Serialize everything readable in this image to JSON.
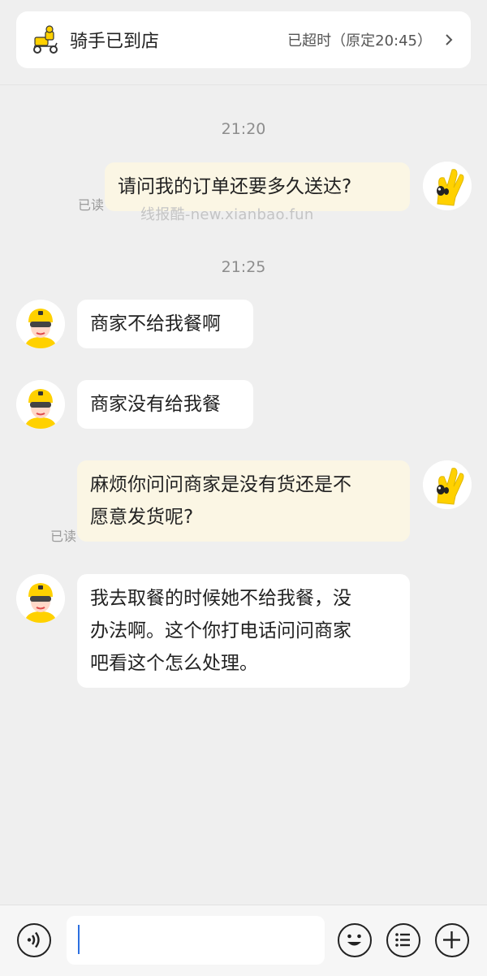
{
  "status": {
    "title": "骑手已到店",
    "time_text": "已超时（原定20:45）"
  },
  "messages": [
    {
      "timestamp": "21:20"
    },
    {
      "from": "me",
      "text": "请问我的订单还要多久送达?",
      "read_label": "已读"
    },
    {
      "timestamp": "21:25"
    },
    {
      "from": "rider",
      "text": "商家不给我餐啊"
    },
    {
      "from": "rider",
      "text": "商家没有给我餐"
    },
    {
      "from": "me",
      "lines": [
        "麻烦你问问商家是没有货还是不",
        "愿意发货呢?"
      ],
      "read_label": "已读"
    },
    {
      "from": "rider",
      "lines": [
        "我去取餐的时候她不给我餐，没",
        "办法啊。这个你打电话问问商家",
        "吧看这个怎么处理。"
      ]
    }
  ],
  "watermark": "线报酷-new.xianbao.fun",
  "input": {
    "placeholder": ""
  },
  "colors": {
    "accent": "#ffd100",
    "me_bubble": "#fbf6e4",
    "caret": "#2b6fe0"
  }
}
